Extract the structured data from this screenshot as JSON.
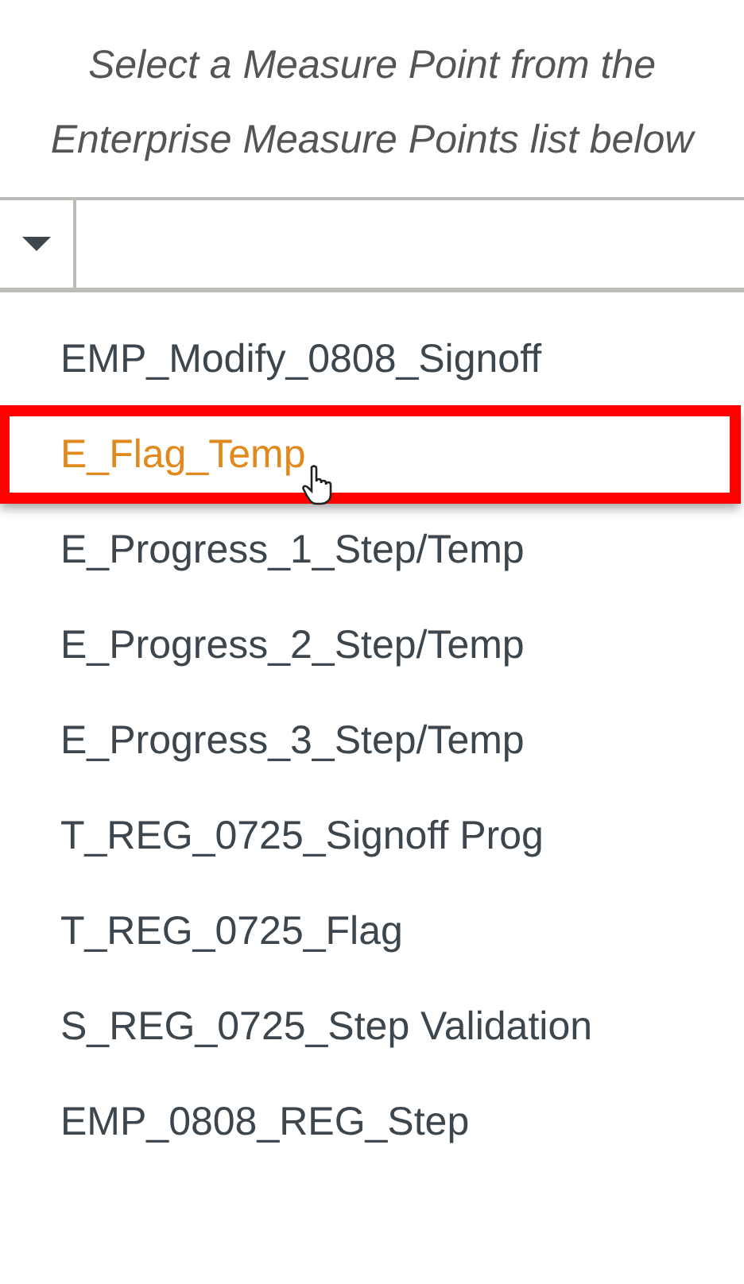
{
  "instruction": "Select a Measure Point from the Enterprise Measure Points list below",
  "items": [
    {
      "label": "EMP_Modify_0808_Signoff",
      "selected": false
    },
    {
      "label": "E_Flag_Temp",
      "selected": true
    },
    {
      "label": "E_Progress_1_Step/Temp",
      "selected": false
    },
    {
      "label": "E_Progress_2_Step/Temp",
      "selected": false
    },
    {
      "label": "E_Progress_3_Step/Temp",
      "selected": false
    },
    {
      "label": "T_REG_0725_Signoff Prog",
      "selected": false
    },
    {
      "label": "T_REG_0725_Flag",
      "selected": false
    },
    {
      "label": "S_REG_0725_Step Validation",
      "selected": false
    },
    {
      "label": "EMP_0808_REG_Step",
      "selected": false
    }
  ]
}
